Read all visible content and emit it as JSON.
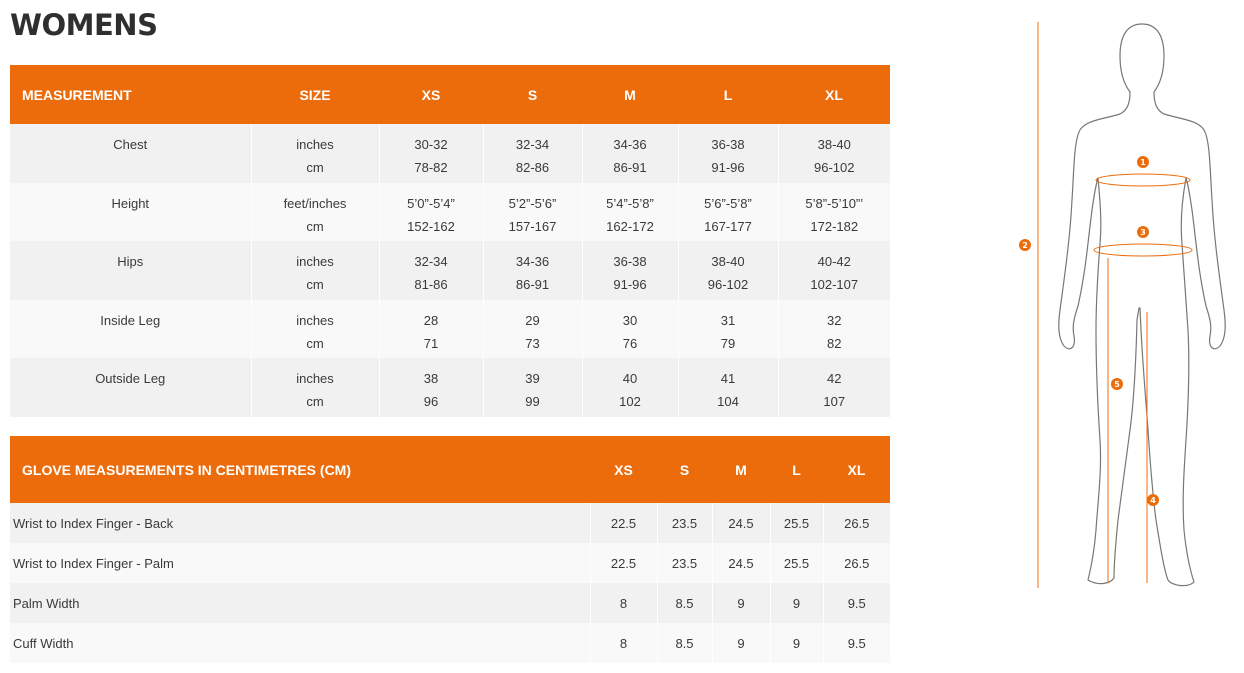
{
  "title": "WOMENS",
  "size_table": {
    "headers": [
      "MEASUREMENT",
      "SIZE",
      "XS",
      "S",
      "M",
      "L",
      "XL"
    ],
    "rows": [
      {
        "measurement": "Chest",
        "units": [
          "inches",
          "cm"
        ],
        "values": [
          [
            "30-32",
            "78-82"
          ],
          [
            "32-34",
            "82-86"
          ],
          [
            "34-36",
            "86-91"
          ],
          [
            "36-38",
            "91-96"
          ],
          [
            "38-40",
            "96-102"
          ]
        ]
      },
      {
        "measurement": "Height",
        "units": [
          "feet/inches",
          "cm"
        ],
        "values": [
          [
            "5’0”-5’4”",
            "152-162"
          ],
          [
            "5’2”-5’6”",
            "157-167"
          ],
          [
            "5’4”-5’8”",
            "162-172"
          ],
          [
            "5’6”-5’8”",
            "167-177"
          ],
          [
            "5’8”-5’10”’",
            "172-182"
          ]
        ]
      },
      {
        "measurement": "Hips",
        "units": [
          "inches",
          "cm"
        ],
        "values": [
          [
            "32-34",
            "81-86"
          ],
          [
            "34-36",
            "86-91"
          ],
          [
            "36-38",
            "91-96"
          ],
          [
            "38-40",
            "96-102"
          ],
          [
            "40-42",
            "102-107"
          ]
        ]
      },
      {
        "measurement": "Inside Leg",
        "units": [
          "inches",
          "cm"
        ],
        "values": [
          [
            "28",
            "71"
          ],
          [
            "29",
            "73"
          ],
          [
            "30",
            "76"
          ],
          [
            "31",
            "79"
          ],
          [
            "32",
            "82"
          ]
        ]
      },
      {
        "measurement": "Outside Leg",
        "units": [
          "inches",
          "cm"
        ],
        "values": [
          [
            "38",
            "96"
          ],
          [
            "39",
            "99"
          ],
          [
            "40",
            "102"
          ],
          [
            "41",
            "104"
          ],
          [
            "42",
            "107"
          ]
        ]
      }
    ]
  },
  "glove_table": {
    "headers": [
      "GLOVE MEASUREMENTS IN CENTIMETRES (CM)",
      "XS",
      "S",
      "M",
      "L",
      "XL"
    ],
    "rows": [
      {
        "label": "Wrist to Index Finger - Back",
        "values": [
          "22.5",
          "23.5",
          "24.5",
          "25.5",
          "26.5"
        ]
      },
      {
        "label": "Wrist to Index Finger - Palm",
        "values": [
          "22.5",
          "23.5",
          "24.5",
          "25.5",
          "26.5"
        ]
      },
      {
        "label": "Palm Width",
        "values": [
          "8",
          "8.5",
          "9",
          "9",
          "9.5"
        ]
      },
      {
        "label": "Cuff Width",
        "values": [
          "8",
          "8.5",
          "9",
          "9",
          "9.5"
        ]
      }
    ]
  },
  "figure": {
    "icon": "body-outline-icon",
    "markers": [
      "1",
      "2",
      "3",
      "4",
      "5"
    ],
    "accent_color": "#ec6c0b",
    "outline_color": "#777777"
  }
}
